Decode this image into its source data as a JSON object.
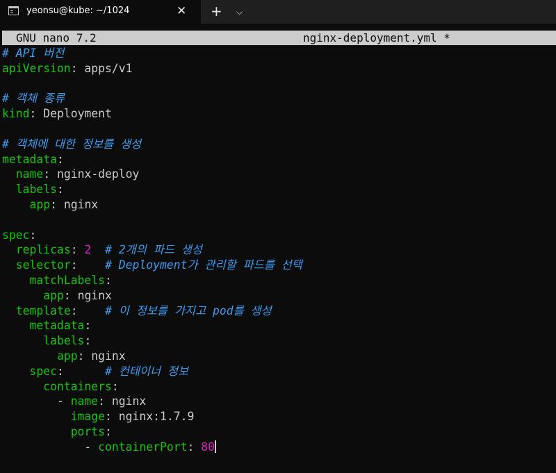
{
  "window": {
    "tab_title": "yeonsu@kube: ~/1024",
    "close_symbol": "✕",
    "new_tab_symbol": "+",
    "dropdown_symbol": "⌵"
  },
  "nano": {
    "version": "GNU nano 7.2",
    "filename": "nginx-deployment.yml *"
  },
  "file_lines": [
    {
      "text": "# API 버전",
      "type": "comment"
    },
    {
      "text": "apiVersion: apps/v1",
      "type": "code"
    },
    {
      "text": "",
      "type": "blank"
    },
    {
      "text": "# 객체 종류",
      "type": "comment"
    },
    {
      "text": "kind: Deployment",
      "type": "code"
    },
    {
      "text": "",
      "type": "blank"
    },
    {
      "text": "# 객체에 대한 정보를 생성",
      "type": "comment"
    },
    {
      "text": "metadata:",
      "type": "code"
    },
    {
      "text": "  name: nginx-deploy",
      "type": "code"
    },
    {
      "text": "  labels:",
      "type": "code"
    },
    {
      "text": "    app: nginx",
      "type": "code"
    },
    {
      "text": "",
      "type": "blank"
    },
    {
      "text": "spec:",
      "type": "code"
    },
    {
      "text": "  replicas: 2  # 2개의 파드 생성",
      "type": "code"
    },
    {
      "text": "  selector:    # Deployment가 관리할 파드를 선택",
      "type": "code"
    },
    {
      "text": "    matchLabels:",
      "type": "code"
    },
    {
      "text": "      app: nginx",
      "type": "code"
    },
    {
      "text": "  template:    # 이 정보를 가지고 pod를 생성",
      "type": "code"
    },
    {
      "text": "    metadata:",
      "type": "code"
    },
    {
      "text": "      labels:",
      "type": "code"
    },
    {
      "text": "        app: nginx",
      "type": "code"
    },
    {
      "text": "    spec:      # 컨테이너 정보",
      "type": "code"
    },
    {
      "text": "      containers:",
      "type": "code"
    },
    {
      "text": "        - name: nginx",
      "type": "code"
    },
    {
      "text": "          image: nginx:1.7.9",
      "type": "code"
    },
    {
      "text": "          ports:",
      "type": "code"
    },
    {
      "text": "            - containerPort: 80",
      "type": "code",
      "cursor": true
    }
  ],
  "colors": {
    "key": "#16c60c",
    "comment": "#3b9cf0",
    "number": "#e31ec0",
    "text": "#cccccc",
    "background": "#0c0c0c"
  }
}
